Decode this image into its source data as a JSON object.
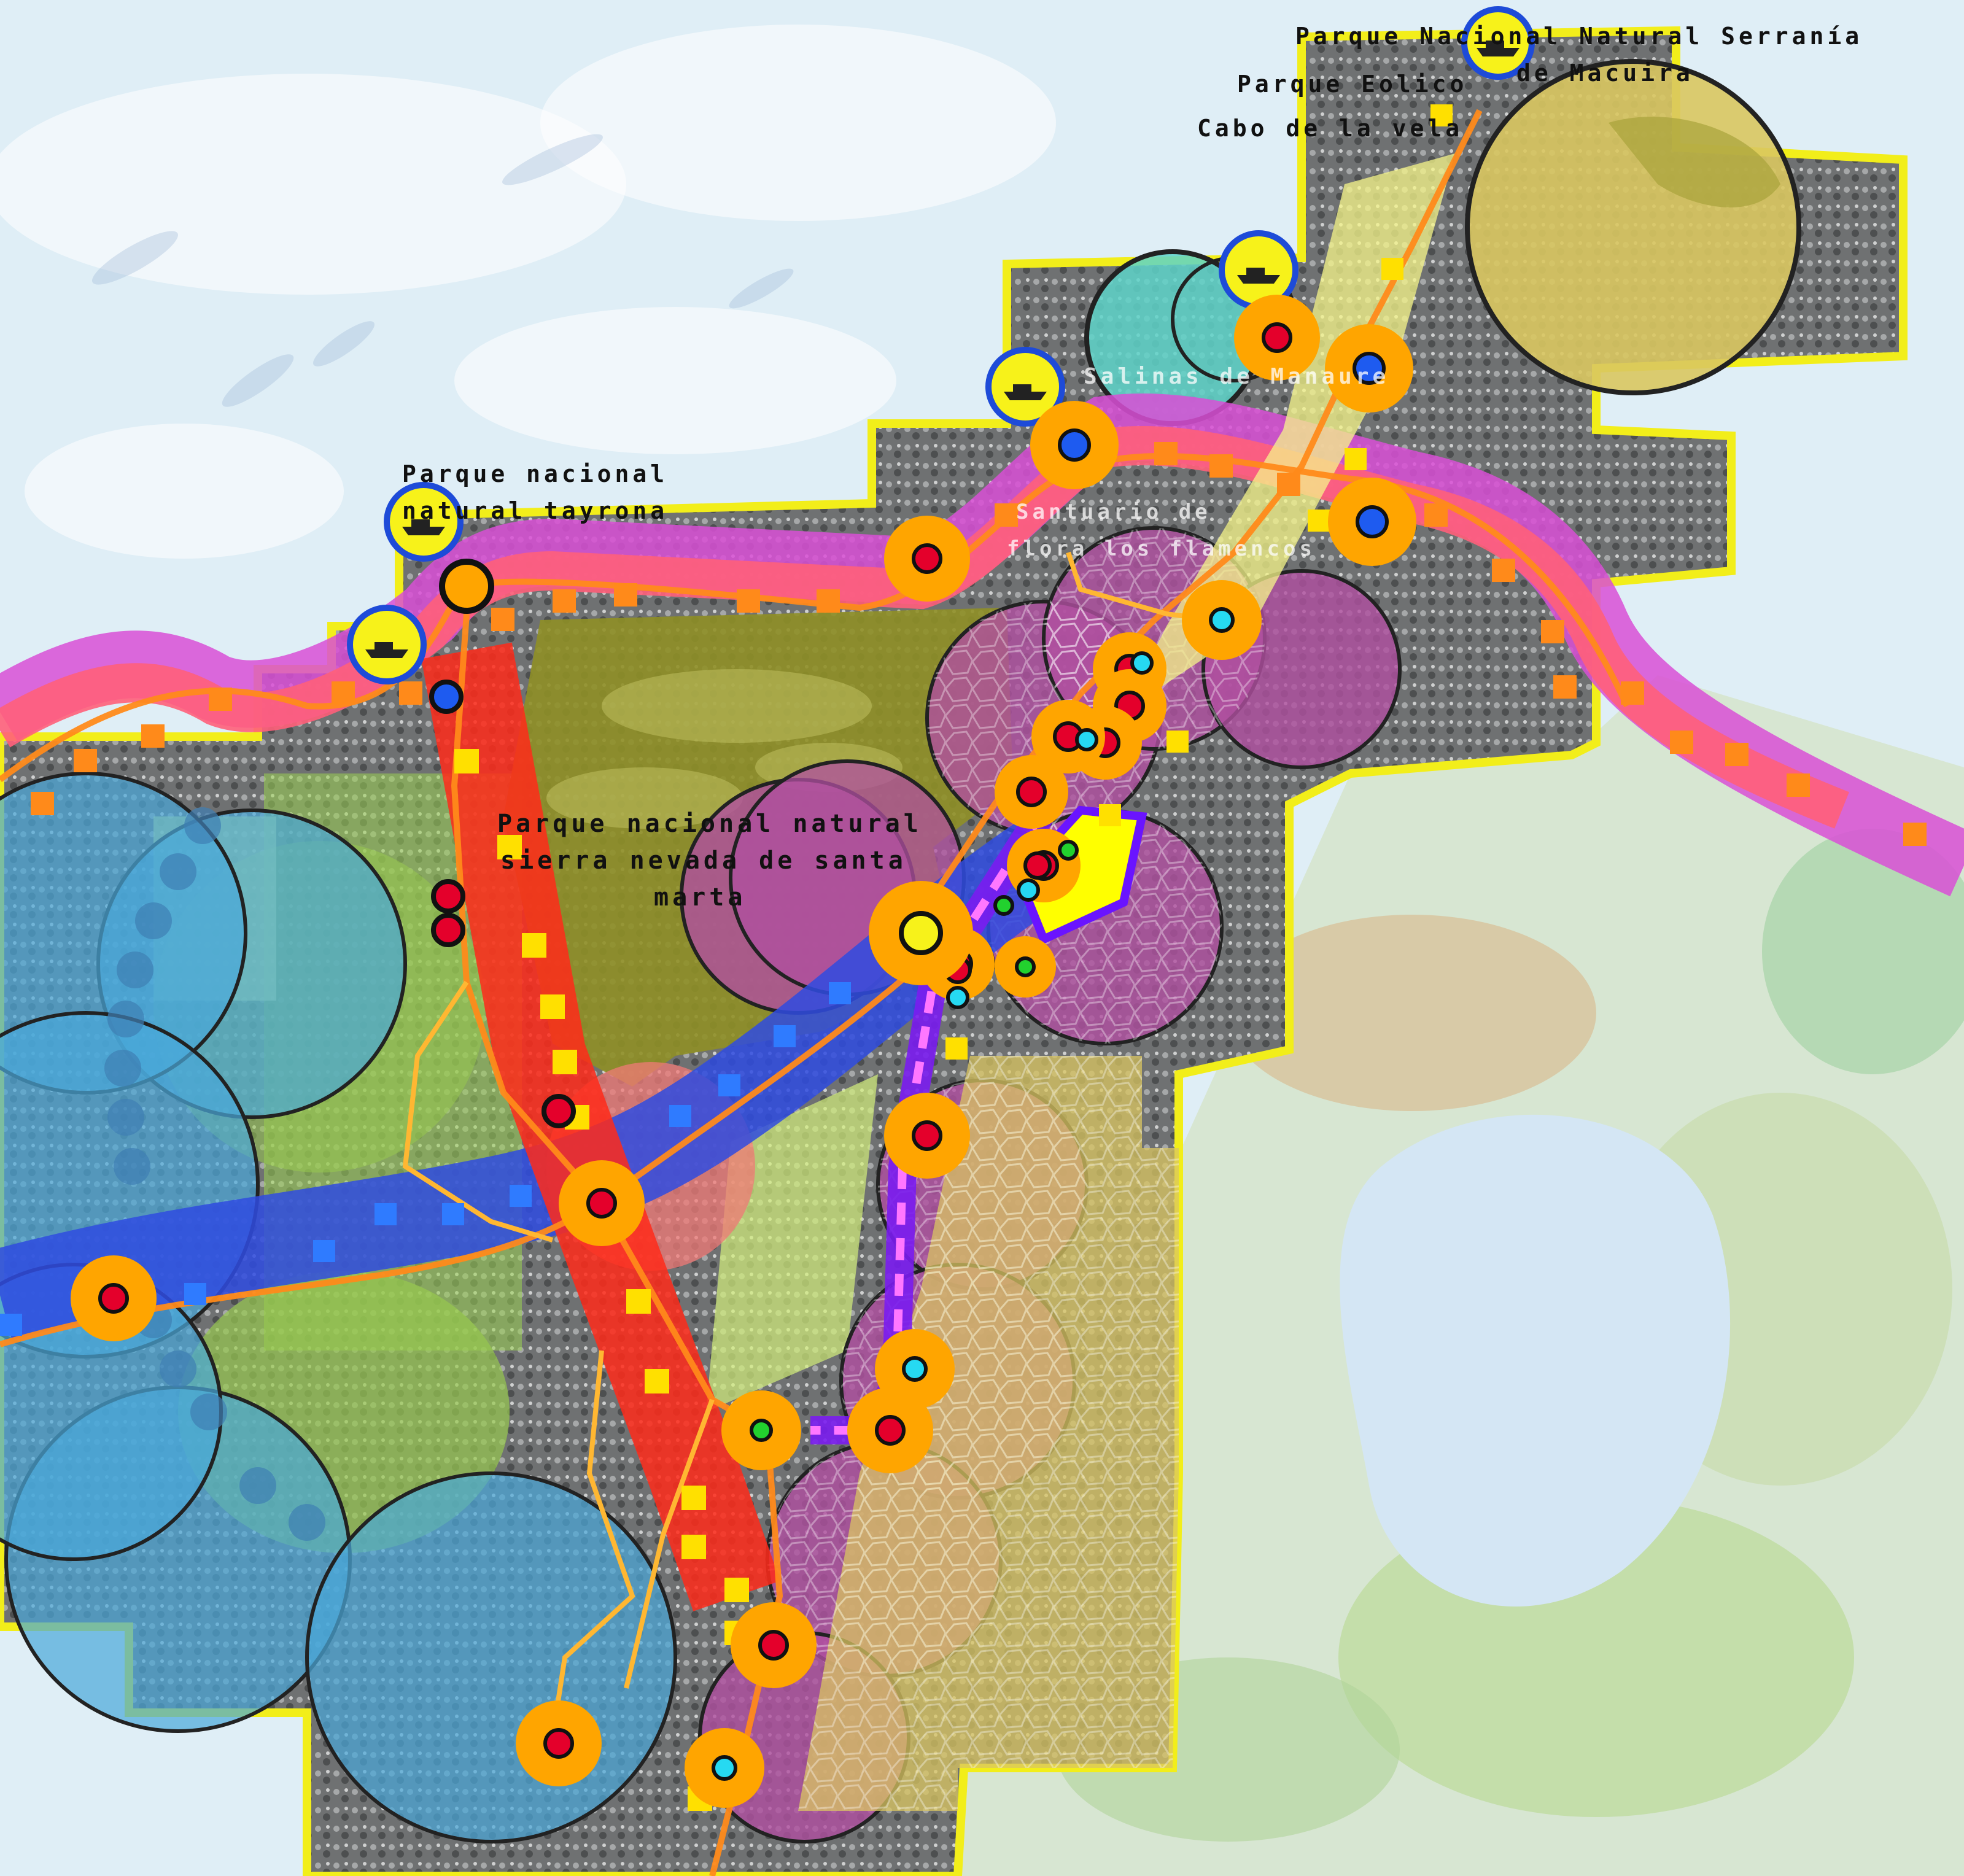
{
  "map": {
    "labels": {
      "serrania_line1": "Parque Nacional Natural Serranía",
      "serrania_line2": "de Macuira",
      "eolico": "Parque Eolico",
      "cabo": "Cabo de la vela",
      "salinas": "Salinas de Manaure",
      "tayrona_line1": "Parque nacional",
      "tayrona_line2": "natural tayrona",
      "sierra_line1": "Parque nacional natural",
      "sierra_line2": "sierra nevada de santa",
      "sierra_line3": "marta",
      "santuario_line1": "Santuario de",
      "santuario_line2": "flora los flamencos"
    },
    "colors": {
      "sea": "#dfeef6",
      "region_fill": "#7d7f80",
      "region_border": "#f2ee1a",
      "park_olive": "#8f8f26",
      "wetland_blue": "#49a8da",
      "green_zone": "#97c94f",
      "purple_zone": "#b04fa0",
      "yellow_zone": "#d9c661",
      "coastal_corridor_magenta": "#d94fd6",
      "coastal_corridor_pink": "#ff5f7a",
      "blue_corridor": "#2f4be0",
      "red_corridor": "#ff2a1a",
      "route_orange": "#ff8a1a",
      "marker_orange": "#ffa500",
      "marker_red": "#e4002b",
      "marker_blue": "#1e5bf0",
      "marker_cyan": "#26d9f2",
      "marker_green": "#22d12e",
      "port_yellow": "#f7f21a",
      "salt_flat_teal": "#5ed3c9",
      "highlight_yellow": "#ffff00"
    },
    "markers": {
      "red_count": 24,
      "blue_count": 4,
      "cyan_count": 7,
      "green_count": 5,
      "port_count": 5
    },
    "icons": {
      "port": "ship-icon",
      "node": "circle-node-icon"
    }
  }
}
